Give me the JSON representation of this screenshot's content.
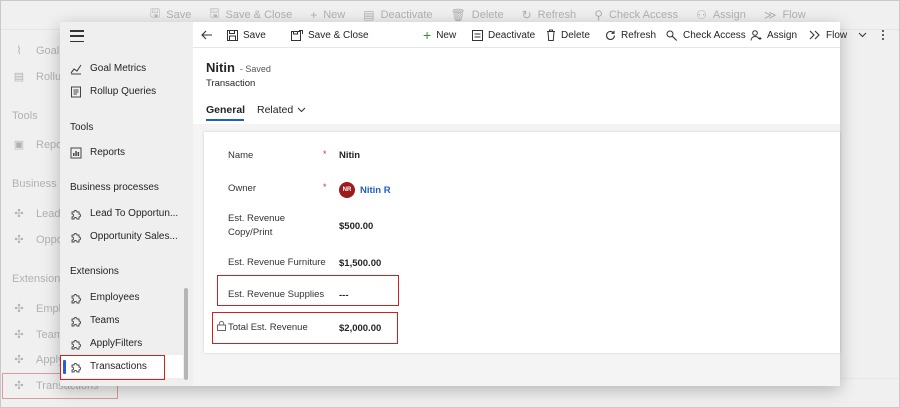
{
  "background": {
    "commands": [
      "Save",
      "Save & Close",
      "New",
      "Deactivate",
      "Delete",
      "Refresh",
      "Check Access",
      "Assign",
      "Flow"
    ],
    "sidebar_items": [
      "Goal Metrics",
      "Rollup Queries",
      "Tools",
      "Reports",
      "Business processes",
      "Lead To Opportunity",
      "Opportunity Sales",
      "Extensions",
      "Employees",
      "Teams",
      "ApplyFilters",
      "Transactions"
    ]
  },
  "nav": {
    "items": [
      {
        "label": "Goal Metrics",
        "icon": "chart-line-icon"
      },
      {
        "label": "Rollup Queries",
        "icon": "document-list-icon"
      }
    ],
    "tools_header": "Tools",
    "tools_items": [
      {
        "label": "Reports",
        "icon": "report-icon"
      }
    ],
    "bp_header": "Business processes",
    "bp_items": [
      {
        "label": "Lead To Opportun...",
        "icon": "puzzle-icon"
      },
      {
        "label": "Opportunity Sales...",
        "icon": "puzzle-icon"
      }
    ],
    "ext_header": "Extensions",
    "ext_items": [
      {
        "label": "Employees",
        "icon": "puzzle-icon"
      },
      {
        "label": "Teams",
        "icon": "puzzle-icon"
      },
      {
        "label": "ApplyFilters",
        "icon": "puzzle-icon"
      },
      {
        "label": "Transactions",
        "icon": "puzzle-icon",
        "selected": true
      }
    ]
  },
  "toolbar": {
    "back": "back-arrow-icon",
    "save": "Save",
    "save_close": "Save & Close",
    "new": "New",
    "deactivate": "Deactivate",
    "delete": "Delete",
    "refresh": "Refresh",
    "check_access": "Check Access",
    "assign": "Assign",
    "flow": "Flow"
  },
  "record": {
    "name": "Nitin",
    "status": "- Saved",
    "entity": "Transaction"
  },
  "tabs": {
    "general": "General",
    "related": "Related"
  },
  "form": {
    "name_label": "Name",
    "name_value": "Nitin",
    "owner_label": "Owner",
    "owner_initials": "NR",
    "owner_value": "Nitin R",
    "rev_copy_label_1": "Est. Revenue",
    "rev_copy_label_2": "Copy/Print",
    "rev_copy_value": "$500.00",
    "rev_furniture_label": "Est. Revenue Furniture",
    "rev_furniture_value": "$1,500.00",
    "rev_supplies_label": "Est. Revenue Supplies",
    "rev_supplies_value": "---",
    "total_label": "Total Est. Revenue",
    "total_value": "$2,000.00",
    "required_marker": "*"
  },
  "colors": {
    "accent": "#1f5fbf",
    "highlight": "#d0201f",
    "avatar": "#9b1c1c"
  }
}
